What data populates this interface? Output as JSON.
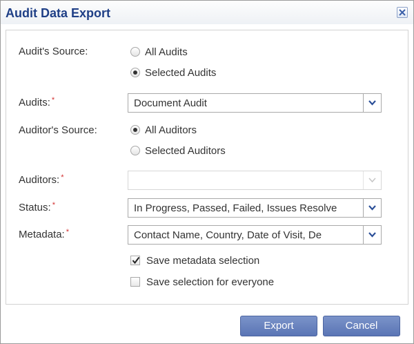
{
  "dialog": {
    "title": "Audit Data Export",
    "close_icon": "close-icon"
  },
  "form": {
    "audit_source": {
      "label": "Audit's Source:",
      "options": [
        {
          "label": "All Audits",
          "checked": false
        },
        {
          "label": "Selected Audits",
          "checked": true
        }
      ]
    },
    "audits": {
      "label": "Audits:",
      "required_mark": "*",
      "value": [
        "Document Audit"
      ]
    },
    "auditor_source": {
      "label": "Auditor's Source:",
      "options": [
        {
          "label": "All Auditors",
          "checked": true
        },
        {
          "label": "Selected Auditors",
          "checked": false
        }
      ]
    },
    "auditors": {
      "label": "Auditors:",
      "required_mark": "*",
      "value": [
        ""
      ],
      "disabled": true
    },
    "status": {
      "label": "Status:",
      "required_mark": "*",
      "value": [
        "In Progress, Passed, Failed, Issues Resolve"
      ]
    },
    "metadata": {
      "label": "Metadata:",
      "required_mark": "*",
      "value": [
        "Contact Name, Country, Date of Visit, De"
      ]
    },
    "save_metadata": {
      "label": "Save metadata selection",
      "checked": true
    },
    "save_for_everyone": {
      "label": "Save selection for everyone",
      "checked": false
    }
  },
  "buttons": {
    "export": "Export",
    "cancel": "Cancel"
  },
  "colors": {
    "title": "#1f3f86",
    "button": "#6880bd",
    "required": "#d23030"
  }
}
